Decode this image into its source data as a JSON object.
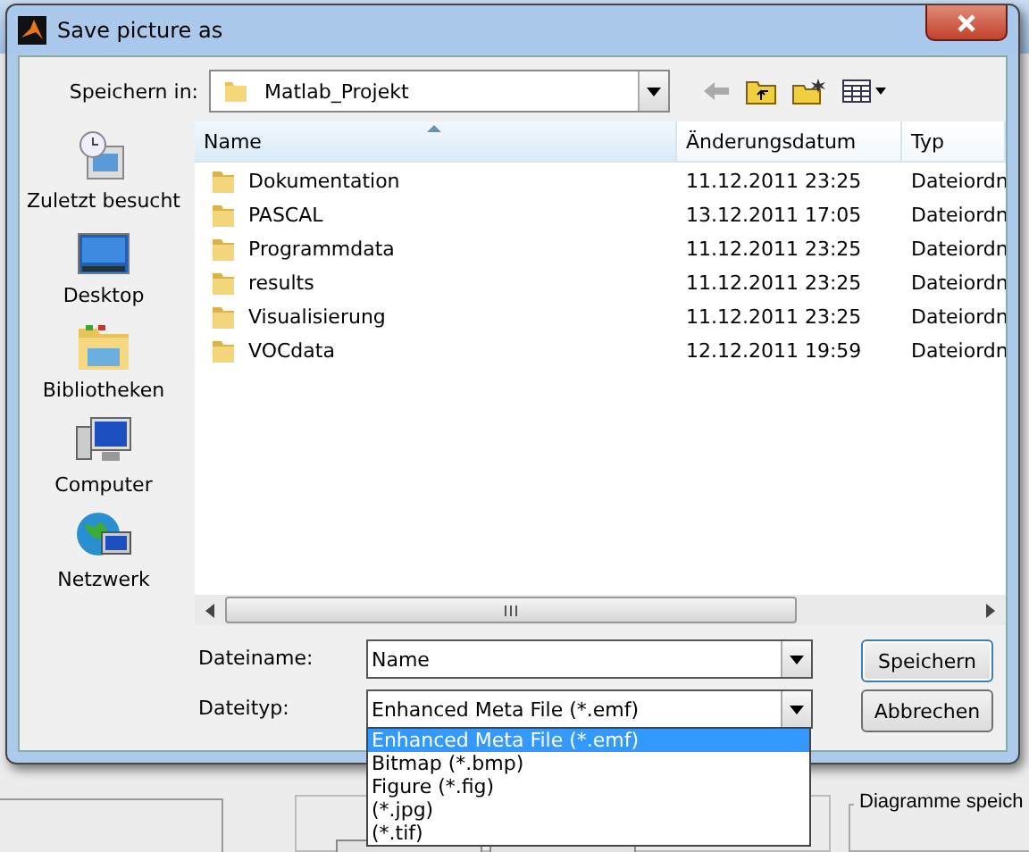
{
  "window": {
    "title": "Save picture as"
  },
  "location": {
    "label": "Speichern in:",
    "value": "Matlab_Projekt"
  },
  "places": [
    {
      "label": "Zuletzt besucht",
      "kind": "recent"
    },
    {
      "label": "Desktop",
      "kind": "desktop"
    },
    {
      "label": "Bibliotheken",
      "kind": "libraries"
    },
    {
      "label": "Computer",
      "kind": "computer"
    },
    {
      "label": "Netzwerk",
      "kind": "network"
    }
  ],
  "table": {
    "columns": [
      "Name",
      "Änderungsdatum",
      "Typ"
    ],
    "rows": [
      {
        "name": "Dokumentation",
        "date": "11.12.2011 23:25",
        "type": "Dateiordn"
      },
      {
        "name": "PASCAL",
        "date": "13.12.2011 17:05",
        "type": "Dateiordn"
      },
      {
        "name": "Programmdata",
        "date": "11.12.2011 23:25",
        "type": "Dateiordn"
      },
      {
        "name": "results",
        "date": "11.12.2011 23:25",
        "type": "Dateiordn"
      },
      {
        "name": "Visualisierung",
        "date": "11.12.2011 23:25",
        "type": "Dateiordn"
      },
      {
        "name": "VOCdata",
        "date": "12.12.2011 19:59",
        "type": "Dateiordn"
      }
    ]
  },
  "filename": {
    "label": "Dateiname:",
    "value": "Name"
  },
  "filetype": {
    "label": "Dateityp:",
    "value": "Enhanced Meta File (*.emf)",
    "options": [
      {
        "label": "Enhanced Meta File (*.emf)",
        "selected": true
      },
      {
        "label": "Bitmap (*.bmp)",
        "selected": false
      },
      {
        "label": "Figure (*.fig)",
        "selected": false
      },
      {
        "label": "(*.jpg)",
        "selected": false
      },
      {
        "label": "(*.tif)",
        "selected": false
      }
    ]
  },
  "buttons": [
    "Speichern",
    "Abbrechen"
  ],
  "background": {
    "group_title": "Diagramme speich"
  }
}
